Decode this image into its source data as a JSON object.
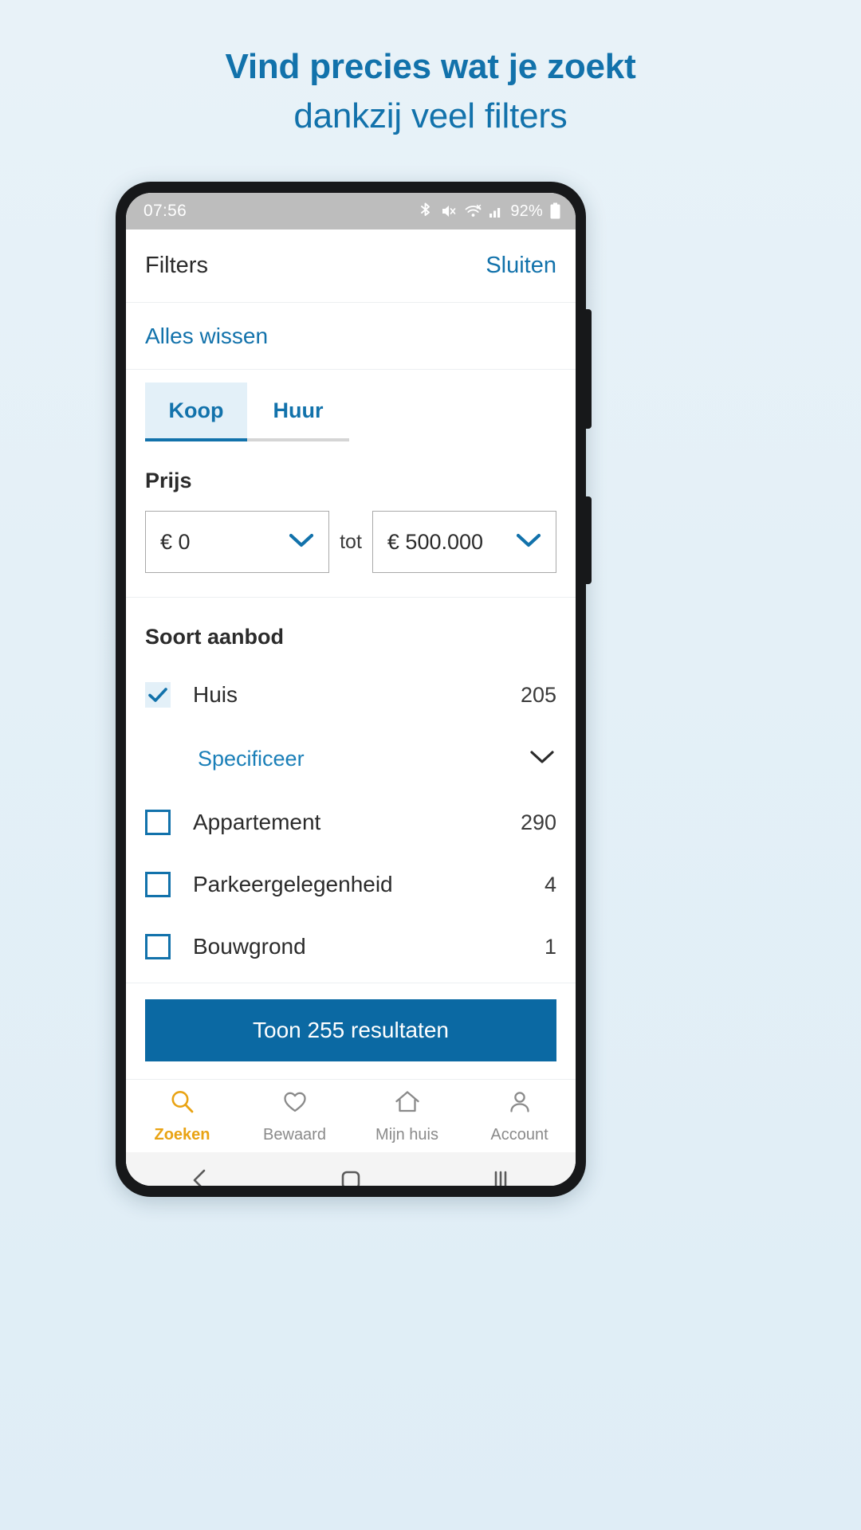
{
  "headline": {
    "line1": "Vind precies wat je zoekt",
    "line2": "dankzij veel filters",
    "color": "#1272ab"
  },
  "status_bar": {
    "time": "07:56",
    "battery_text": "92%",
    "icons": [
      "bluetooth-icon",
      "mute-icon",
      "wifi-icon",
      "signal-icon",
      "battery-icon"
    ]
  },
  "header": {
    "title": "Filters",
    "close_label": "Sluiten"
  },
  "clear_all": {
    "label": "Alles wissen"
  },
  "tabs": [
    {
      "label": "Koop",
      "active": true
    },
    {
      "label": "Huur",
      "active": false
    }
  ],
  "price": {
    "section_title": "Prijs",
    "min_value": "€ 0",
    "separator": "tot",
    "max_value": "€ 500.000"
  },
  "offer_type": {
    "section_title": "Soort aanbod",
    "specify_label": "Specificeer",
    "items": [
      {
        "label": "Huis",
        "count": "205",
        "checked": true
      },
      {
        "label": "Appartement",
        "count": "290",
        "checked": false
      },
      {
        "label": "Parkeergelegenheid",
        "count": "4",
        "checked": false
      },
      {
        "label": "Bouwgrond",
        "count": "1",
        "checked": false
      }
    ]
  },
  "cta": {
    "label": "Toon 255 resultaten",
    "color": "#0b69a3"
  },
  "bottom_nav": {
    "active_color": "#e9a313",
    "inactive_color": "#8a8a8a",
    "items": [
      {
        "label": "Zoeken",
        "icon": "search-icon",
        "active": true
      },
      {
        "label": "Bewaard",
        "icon": "heart-icon",
        "active": false
      },
      {
        "label": "Mijn huis",
        "icon": "home-icon",
        "active": false
      },
      {
        "label": "Account",
        "icon": "person-icon",
        "active": false
      }
    ]
  },
  "system_nav": {
    "items": [
      "back-icon",
      "home-square-icon",
      "recents-icon"
    ]
  }
}
